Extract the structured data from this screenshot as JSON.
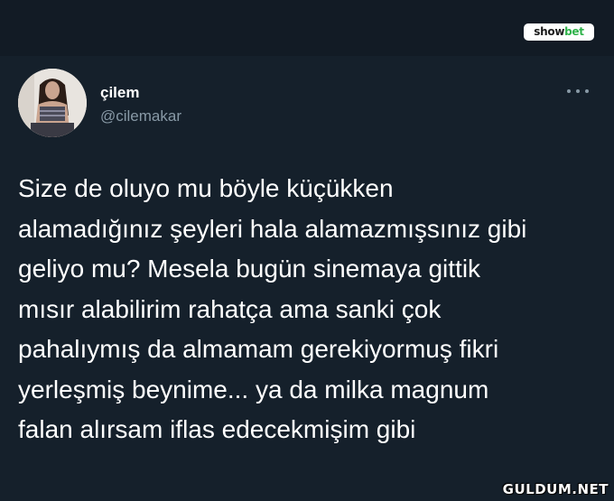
{
  "brand": {
    "logo_part1": "show",
    "logo_part2": "bet"
  },
  "tweet": {
    "display_name": "çilem",
    "handle": "@cilemakar",
    "more_icon": "more-horizontal-icon",
    "text_lines": [
      "Size de oluyo mu böyle küçükken",
      "alamadığınız şeyleri hala alamazmışsınız gibi",
      "geliyo mu? Mesela bugün sinemaya gittik",
      "mısır alabilirim rahatça ama sanki çok",
      "pahalıymış da almamam gerekiyormuş fikri",
      "yerleşmiş beynime... ya da milka magnum",
      "falan alırsam iflas edecekmişim gibi"
    ]
  },
  "watermark": "GULDUM.NET",
  "colors": {
    "background": "#15202b",
    "secondary_text": "#8899a6",
    "logo_green": "#2fb24a"
  }
}
